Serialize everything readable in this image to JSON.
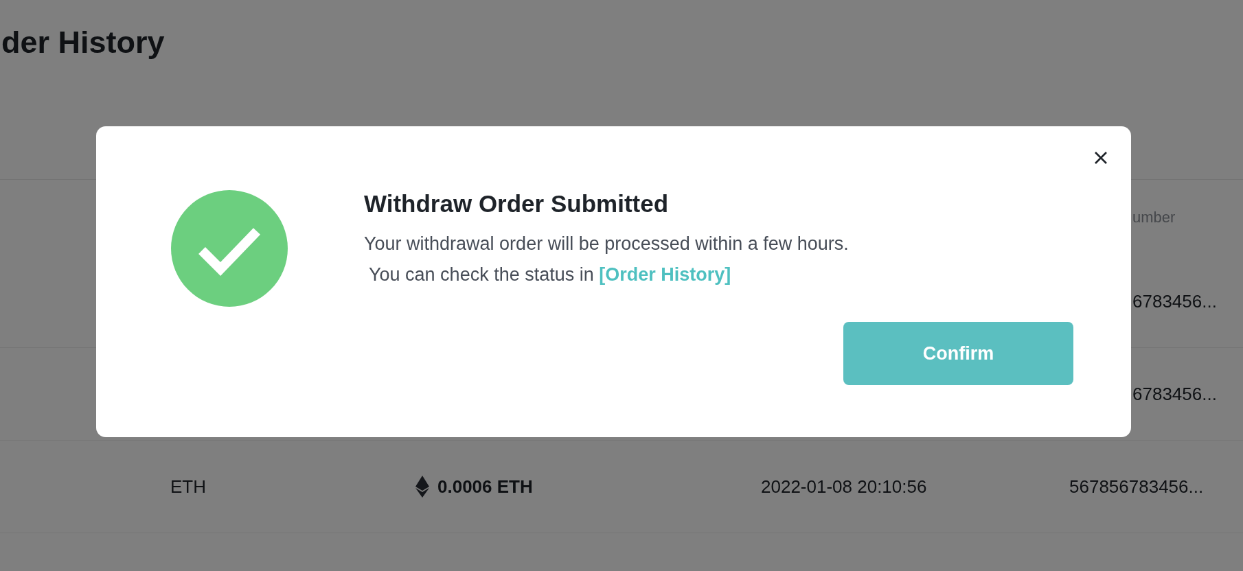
{
  "page": {
    "title": "der History"
  },
  "table": {
    "header": {
      "column_4": "umber"
    },
    "rows": [
      {
        "column_4": "6783456..."
      },
      {
        "column_4": "6783456..."
      },
      {
        "asset": "ETH",
        "amount": "0.0006 ETH",
        "time": "2022-01-08 20:10:56",
        "column_4": "567856783456..."
      }
    ]
  },
  "dialog": {
    "title": "Withdraw Order Submitted",
    "message": "Your withdrawal order will be processed within a few hours.",
    "message_2": " You can check the status in ",
    "link": "[Order History]",
    "confirm": "Confirm"
  }
}
